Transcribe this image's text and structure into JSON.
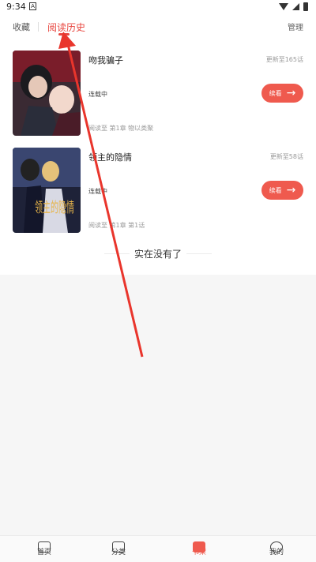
{
  "status_bar": {
    "time": "9:34",
    "notice": "A"
  },
  "tabs": {
    "favorites": "收藏",
    "history": "阅读历史",
    "manage": "管理"
  },
  "items": [
    {
      "title": "吻我骗子",
      "update": "更新至165话",
      "status": "连载中",
      "progress": "阅读至 第1章 物以类聚",
      "button": "续看"
    },
    {
      "title": "领主的隐情",
      "update": "更新至58话",
      "status": "连载中",
      "progress": "阅读至 第1章 第1话",
      "button": "续看"
    }
  ],
  "cover_text": "领主的隐情",
  "end_text": "实在没有了",
  "nav": {
    "home": "首页",
    "category": "分类",
    "shelf": "书架",
    "mine": "我的"
  },
  "colors": {
    "accent": "#e8463f",
    "button": "#ef5a4e",
    "arrow_annotation": "#e9352c"
  },
  "icons": {
    "arrow": "right-arrow-icon"
  }
}
